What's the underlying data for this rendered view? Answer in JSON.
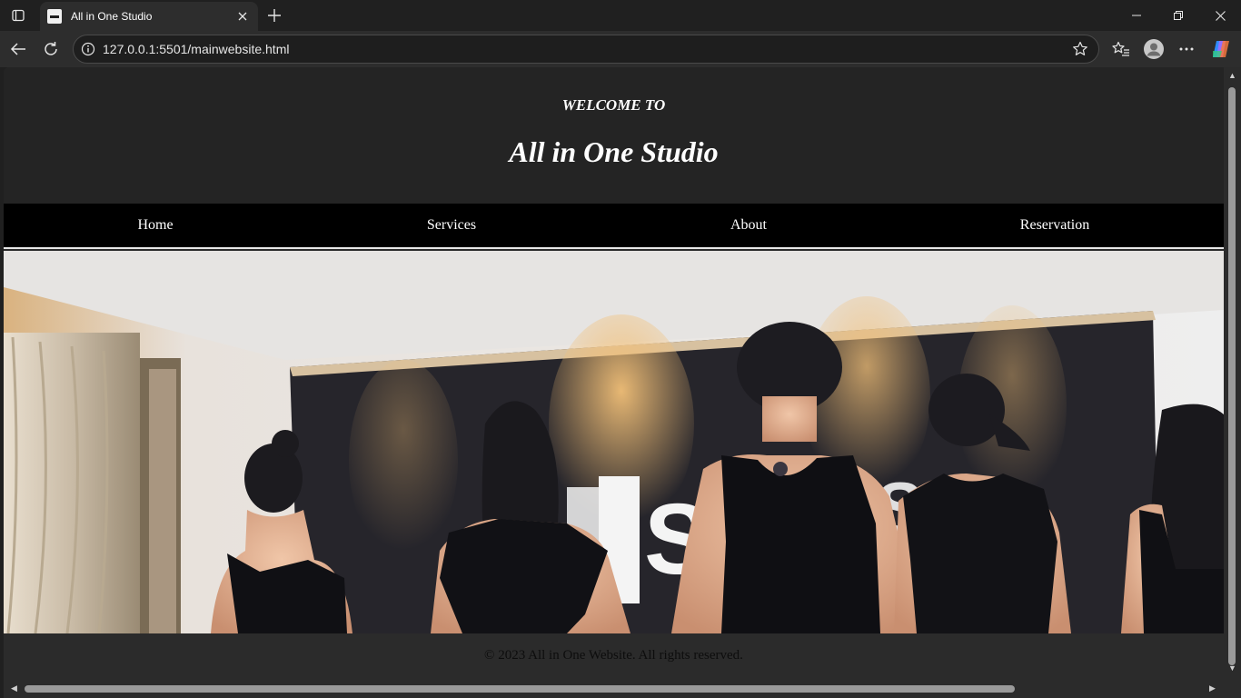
{
  "browser": {
    "tab_title": "All in One Studio",
    "url": "127.0.0.1:5501/mainwebsite.html"
  },
  "page": {
    "welcome": "WELCOME TO",
    "title": "All in One Studio",
    "nav": [
      "Home",
      "Services",
      "About",
      "Reservation"
    ],
    "hero_sign_text": "ALL SI",
    "footer": "© 2023 All in One Website. All rights reserved."
  },
  "icons": [
    "tab-actions-icon",
    "close-icon",
    "plus-icon",
    "minimize-icon",
    "restore-icon",
    "back-icon",
    "refresh-icon",
    "info-icon",
    "star-icon",
    "favorites-icon",
    "profile-icon",
    "more-icon",
    "copilot-icon"
  ],
  "colors": {
    "header_bg": "#242424",
    "nav_bg": "#000000",
    "text": "#ffffff",
    "footer_text": "#0d0d0d"
  }
}
